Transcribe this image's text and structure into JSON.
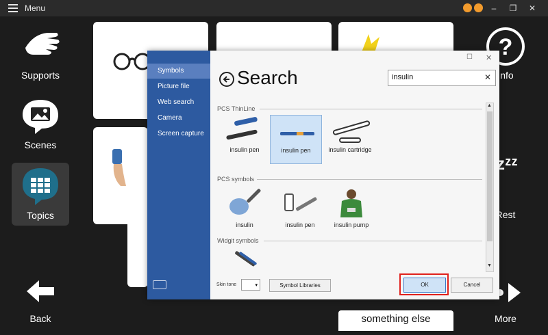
{
  "titlebar": {
    "title": "Menu"
  },
  "sidebar_left": {
    "supports": "Supports",
    "scenes": "Scenes",
    "topics": "Topics",
    "back": "Back"
  },
  "sidebar_right": {
    "info": "Info",
    "rest": "Rest",
    "more": "More"
  },
  "background": {
    "something_else": "something else"
  },
  "dialog": {
    "nav": [
      "Symbols",
      "Picture file",
      "Web search",
      "Camera",
      "Screen capture"
    ],
    "title": "Search",
    "search_value": "insulin",
    "sections": {
      "thinline": "PCS ThinLine",
      "pcs": "PCS symbols",
      "widgit": "Widgit symbols"
    },
    "thinline_items": [
      "insulin pen",
      "insulin pen",
      "insulin cartridge"
    ],
    "pcs_items": [
      "insulin",
      "insulin pen",
      "insulin pump"
    ],
    "skin_tone_label": "Skin tone",
    "symbol_libraries": "Symbol Libraries",
    "ok": "OK",
    "cancel": "Cancel"
  },
  "colors": {
    "dialog_sidebar": "#2d5aa0",
    "selected_nav": "#5a7fbf",
    "selected_symbol": "#cfe3f7",
    "ok_highlight": "#e0201b"
  }
}
